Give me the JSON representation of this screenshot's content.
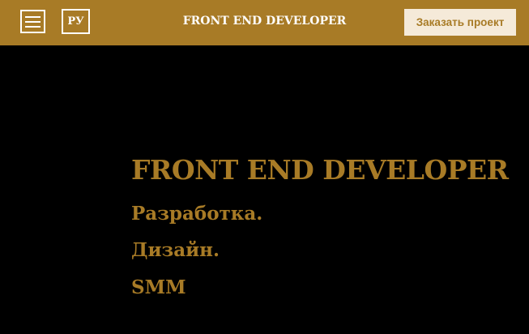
{
  "header": {
    "lang_label": "РУ",
    "title": "FRONT END DEVELOPER",
    "order_button_label": "Заказать проект"
  },
  "hero": {
    "title": "FRONT END DEVELOPER",
    "lines": [
      "Разработка.",
      "Дизайн.",
      "SMM"
    ]
  },
  "colors": {
    "accent": "#a87b26",
    "background": "#000000",
    "button_bg": "#f5ead9"
  },
  "icons": {
    "menu": "hamburger-menu-icon"
  }
}
